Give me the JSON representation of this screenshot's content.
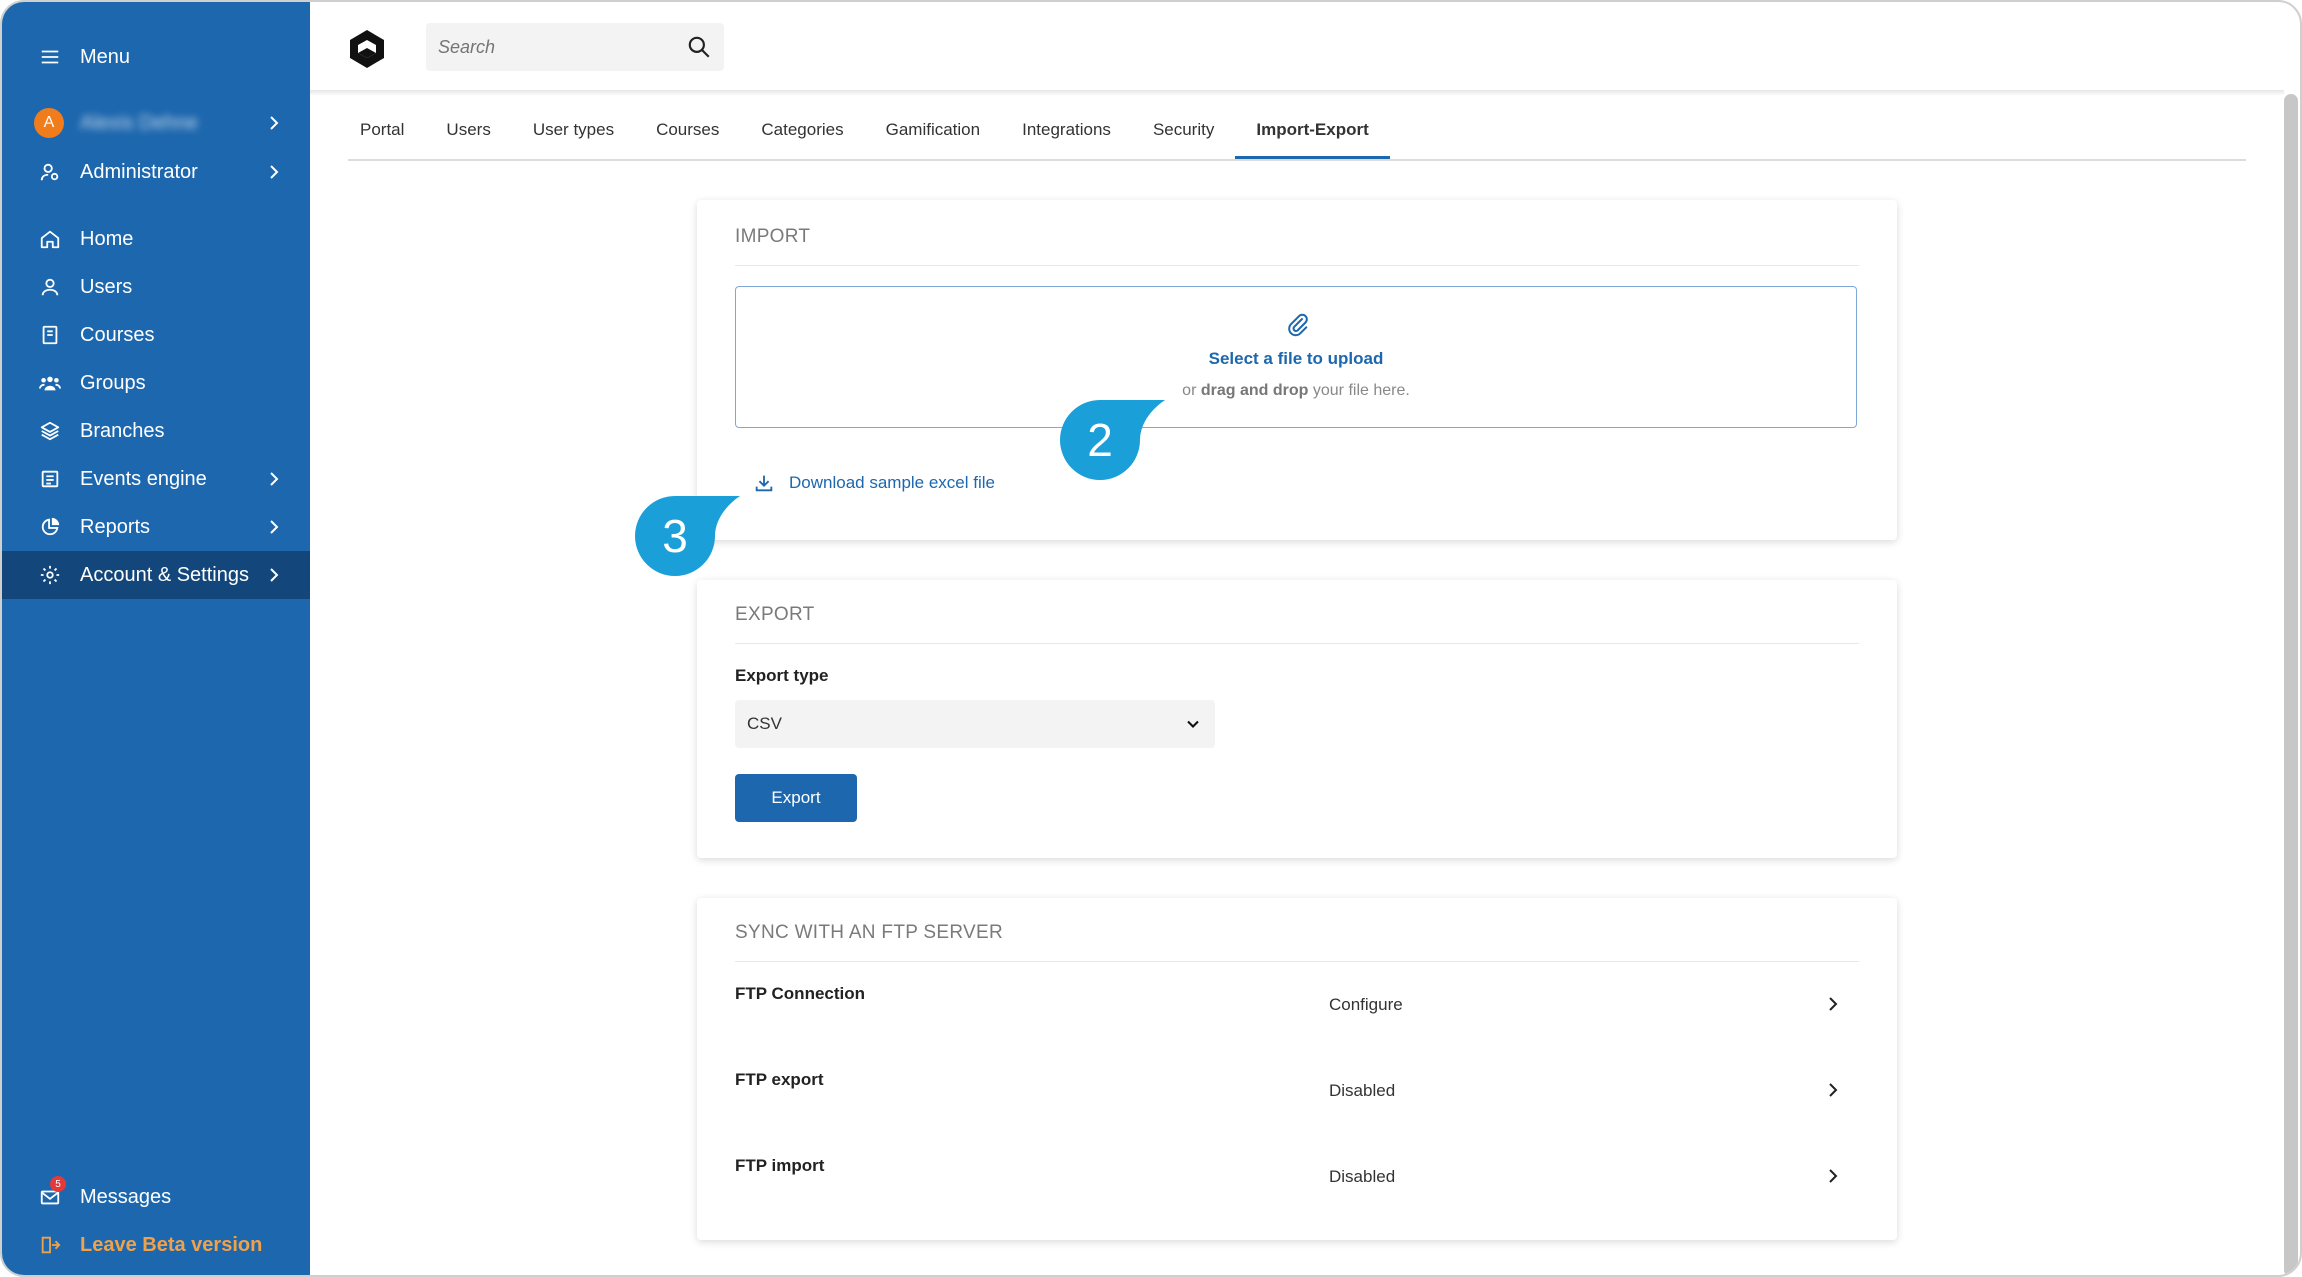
{
  "sidebar": {
    "menu_label": "Menu",
    "user": {
      "initial": "A",
      "name": "Alexis Dehne"
    },
    "role_label": "Administrator",
    "items": [
      {
        "label": "Home",
        "icon": "home-icon"
      },
      {
        "label": "Users",
        "icon": "user-icon"
      },
      {
        "label": "Courses",
        "icon": "book-icon"
      },
      {
        "label": "Groups",
        "icon": "groups-icon"
      },
      {
        "label": "Branches",
        "icon": "layers-icon"
      },
      {
        "label": "Events engine",
        "icon": "events-icon"
      },
      {
        "label": "Reports",
        "icon": "pie-chart-icon"
      },
      {
        "label": "Account & Settings",
        "icon": "gear-icon"
      }
    ],
    "messages_label": "Messages",
    "messages_badge": "5",
    "leave_beta_label": "Leave Beta version",
    "colors": {
      "background": "#1d67ae",
      "active": "#13467a",
      "accent": "#f0a24a"
    }
  },
  "header": {
    "search_placeholder": "Search"
  },
  "tabs": [
    {
      "label": "Portal"
    },
    {
      "label": "Users"
    },
    {
      "label": "User types"
    },
    {
      "label": "Courses"
    },
    {
      "label": "Categories"
    },
    {
      "label": "Gamification"
    },
    {
      "label": "Integrations"
    },
    {
      "label": "Security"
    },
    {
      "label": "Import-Export",
      "active": true
    }
  ],
  "import": {
    "title": "IMPORT",
    "upload_link": "Select a file to upload",
    "drop_prefix": "or",
    "drop_bold": "drag and drop",
    "drop_suffix": "your file here.",
    "download_label": "Download sample excel file"
  },
  "export": {
    "title": "EXPORT",
    "type_label": "Export type",
    "type_value": "CSV",
    "button_label": "Export"
  },
  "ftp": {
    "title": "SYNC WITH AN FTP SERVER",
    "rows": [
      {
        "label": "FTP Connection",
        "value": "Configure"
      },
      {
        "label": "FTP export",
        "value": "Disabled"
      },
      {
        "label": "FTP import",
        "value": "Disabled"
      }
    ]
  },
  "callouts": [
    {
      "number": "2",
      "color": "#1a9fd8"
    },
    {
      "number": "3",
      "color": "#1a9fd8"
    }
  ]
}
